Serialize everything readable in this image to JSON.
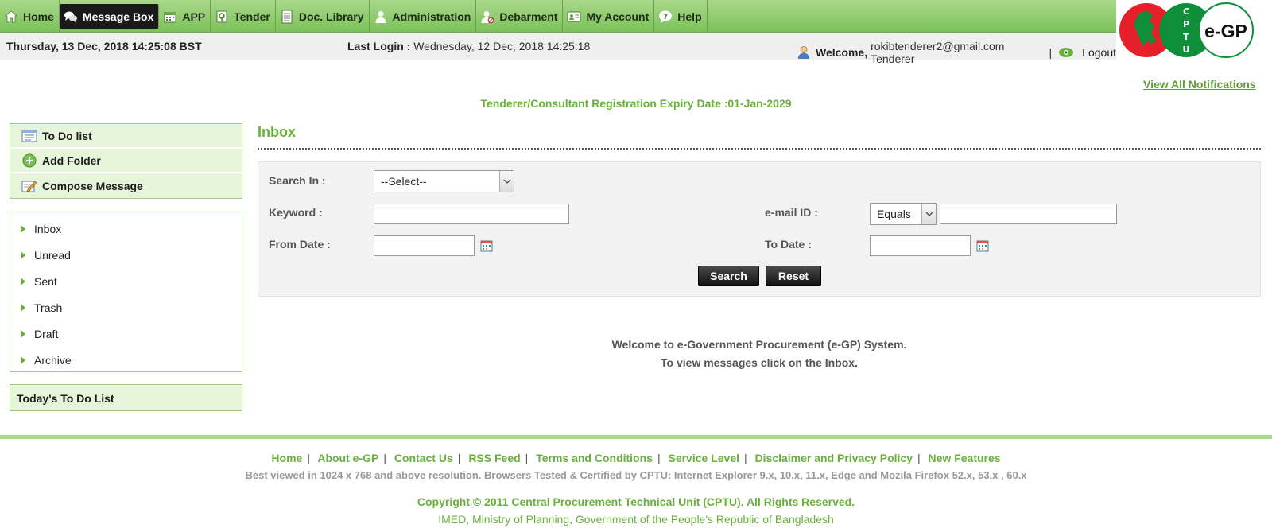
{
  "nav": {
    "items": [
      {
        "label": "Home",
        "icon": "home-icon"
      },
      {
        "label": "Message Box",
        "icon": "chat-bubbles-icon",
        "active": true
      },
      {
        "label": "APP",
        "icon": "calendar-icon"
      },
      {
        "label": "Tender",
        "icon": "tender-icon"
      },
      {
        "label": "Doc. Library",
        "icon": "document-icon"
      },
      {
        "label": "Administration",
        "icon": "user-icon"
      },
      {
        "label": "Debarment",
        "icon": "debarment-icon"
      },
      {
        "label": "My Account",
        "icon": "id-card-icon"
      },
      {
        "label": "Help",
        "icon": "help-icon"
      }
    ]
  },
  "logo": {
    "text": "e-GP",
    "ring_letters": "CPTU",
    "colors": {
      "red": "#e5202a",
      "green": "#0f8f3a"
    }
  },
  "infobar": {
    "date": "Thursday, 13 Dec, 2018 14:25:08 BST",
    "last_login_label": "Last Login :",
    "last_login_value": "Wednesday, 12 Dec, 2018 14:25:18",
    "welcome_label": "Welcome,",
    "welcome_user": "rokibtenderer2@gmail.com Tenderer",
    "separator": "|",
    "logout": "Logout"
  },
  "notifications": {
    "view_all": "View All Notifications"
  },
  "expiry": "Tenderer/Consultant Registration Expiry Date :01-Jan-2029",
  "sidebar": {
    "actions": [
      {
        "label": "To Do list",
        "icon": "list-icon"
      },
      {
        "label": "Add Folder",
        "icon": "add-circle-icon"
      },
      {
        "label": "Compose Message",
        "icon": "compose-icon"
      }
    ],
    "folders": [
      "Inbox",
      "Unread",
      "Sent",
      "Trash",
      "Draft",
      "Archive"
    ],
    "today_todo": "Today's To Do List"
  },
  "main": {
    "title": "Inbox",
    "search": {
      "search_in_label": "Search In :",
      "search_in_value": "--Select--",
      "keyword_label": "Keyword :",
      "keyword_value": "",
      "email_label": "e-mail ID :",
      "email_operator": "Equals",
      "email_value": "",
      "from_date_label": "From Date :",
      "from_date_value": "",
      "to_date_label": "To Date :",
      "to_date_value": "",
      "search_button": "Search",
      "reset_button": "Reset"
    },
    "welcome_line1": "Welcome to e-Government Procurement (e-GP) System.",
    "welcome_line2": "To view messages click on the Inbox."
  },
  "footer": {
    "links": [
      "Home",
      "About e-GP",
      "Contact Us",
      "RSS Feed",
      "Terms and Conditions",
      "Service Level",
      "Disclaimer and Privacy Policy",
      "New Features"
    ],
    "link_separator": "|",
    "best_viewed": "Best viewed in 1024 x 768 and above resolution. Browsers Tested & Certified by CPTU: Internet Explorer 9.x, 10.x, 11.x, Edge and Mozila Firefox 52.x, 53.x , 60.x",
    "copyright": "Copyright © 2011 Central Procurement Technical Unit (CPTU). All Rights Reserved.",
    "imed": "IMED, Ministry of Planning, Government of the People's Republic of Bangladesh"
  },
  "colors": {
    "accent_green": "#6ab03c",
    "nav_green": "#7cc15a",
    "panel_bg": "#e6f5d9"
  }
}
